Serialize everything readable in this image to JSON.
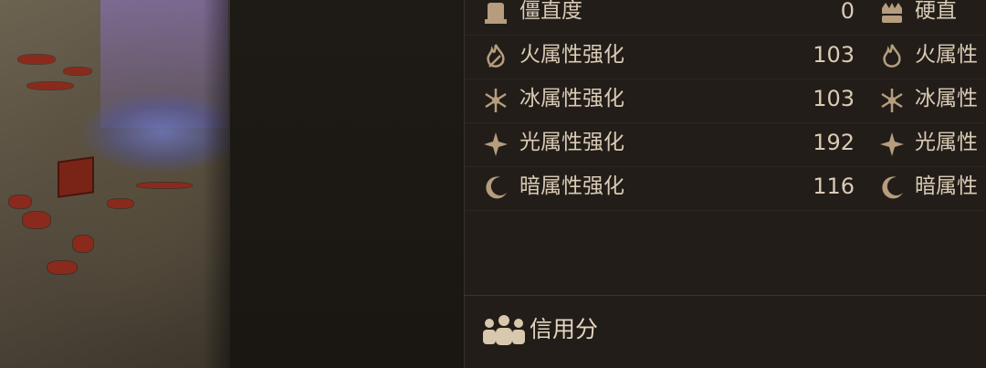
{
  "stats": [
    {
      "icon": "stiffness-icon",
      "label": "僵直度",
      "value": "0",
      "icon2": "hard-stiffness-icon",
      "label2": "硬直"
    },
    {
      "icon": "fire-icon",
      "label": "火属性强化",
      "value": "103",
      "icon2": "fire-icon",
      "label2": "火属性"
    },
    {
      "icon": "ice-icon",
      "label": "冰属性强化",
      "value": "103",
      "icon2": "ice-icon",
      "label2": "冰属性"
    },
    {
      "icon": "light-icon",
      "label": "光属性强化",
      "value": "192",
      "icon2": "light-icon",
      "label2": "光属性"
    },
    {
      "icon": "dark-icon",
      "label": "暗属性强化",
      "value": "116",
      "icon2": "dark-icon",
      "label2": "暗属性"
    }
  ],
  "credit": {
    "label": "信用分",
    "icon": "people-icon"
  },
  "colors": {
    "panel_bg": "#221d19",
    "text": "#d9cbb4",
    "icon": "#b59d7d"
  }
}
